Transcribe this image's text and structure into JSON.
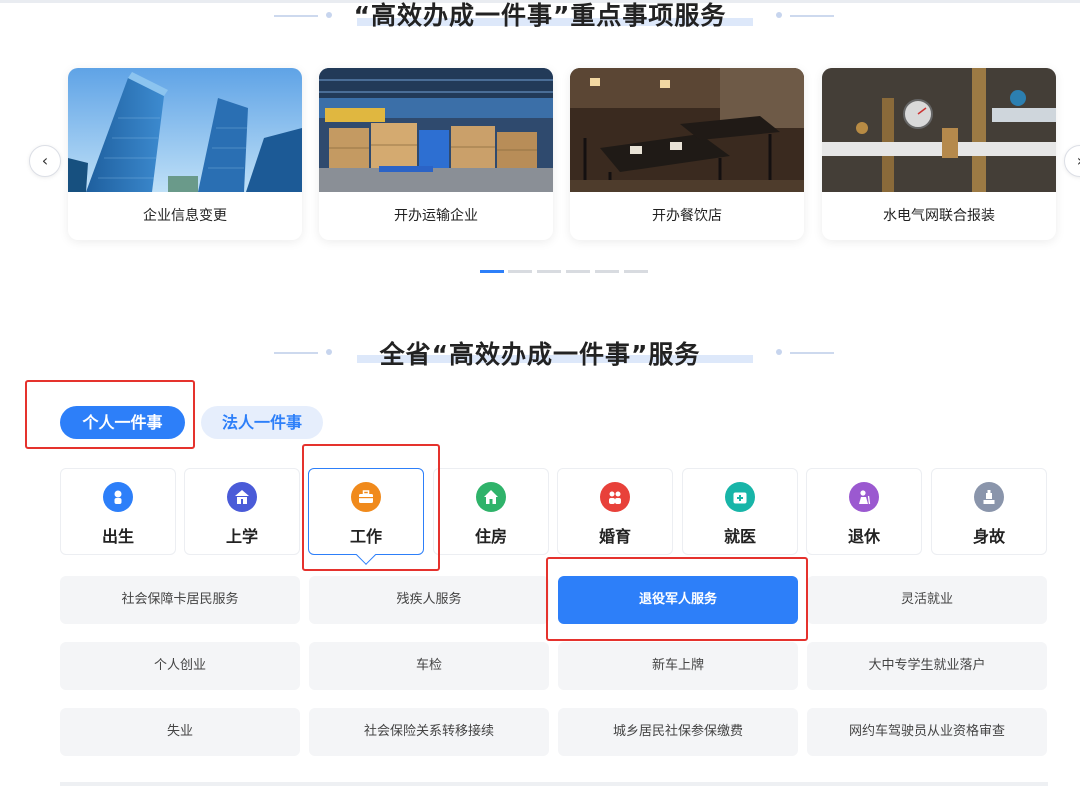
{
  "featured": {
    "title": "“高效办成一件事”重点事项服务",
    "cards": [
      {
        "label": "企业信息变更"
      },
      {
        "label": "开办运输企业"
      },
      {
        "label": "开办餐饮店"
      },
      {
        "label": "水电气网联合报装"
      }
    ],
    "prev_arrow": "‹",
    "next_arrow": "›",
    "pagination": {
      "count": 6,
      "active_index": 0
    }
  },
  "province": {
    "title": "全省“高效办成一件事”服务",
    "tabs": [
      {
        "label": "个人一件事",
        "active": true
      },
      {
        "label": "法人一件事",
        "active": false
      }
    ],
    "categories": [
      {
        "label": "出生",
        "icon": "baby-icon",
        "color": "#2d7ff9"
      },
      {
        "label": "上学",
        "icon": "school-icon",
        "color": "#4a5bd8"
      },
      {
        "label": "工作",
        "icon": "briefcase-icon",
        "color": "#f08a1c",
        "selected": true
      },
      {
        "label": "住房",
        "icon": "house-icon",
        "color": "#2fb36a"
      },
      {
        "label": "婚育",
        "icon": "couple-icon",
        "color": "#e8413a"
      },
      {
        "label": "就医",
        "icon": "medical-kit-icon",
        "color": "#18b5a8"
      },
      {
        "label": "退休",
        "icon": "retiree-icon",
        "color": "#9b59d0"
      },
      {
        "label": "身故",
        "icon": "memorial-icon",
        "color": "#8a95ab"
      }
    ],
    "services": [
      [
        "社会保障卡居民服务",
        "残疾人服务",
        "退役军人服务",
        "灵活就业"
      ],
      [
        "个人创业",
        "车检",
        "新车上牌",
        "大中专学生就业落户"
      ],
      [
        "失业",
        "社会保险关系转移接续",
        "城乡居民社保参保缴费",
        "网约车驾驶员从业资格审查"
      ]
    ],
    "highlighted_service": "退役军人服务"
  },
  "colors": {
    "accent": "#2d7ff9",
    "annotation": "#e5322d"
  }
}
